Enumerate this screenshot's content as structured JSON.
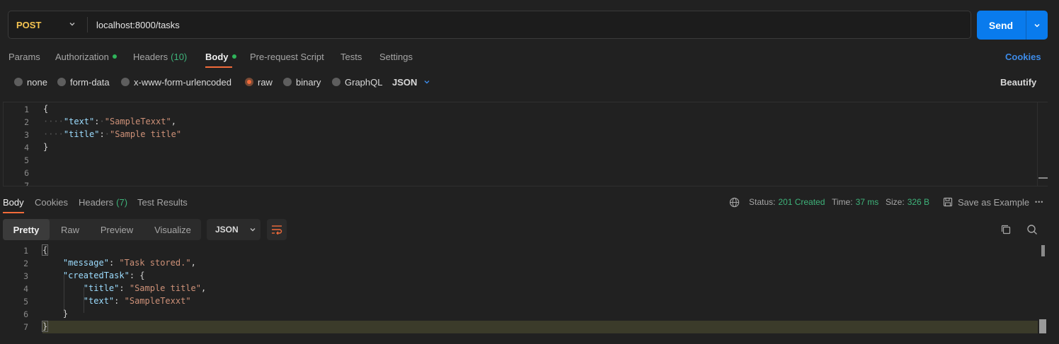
{
  "request": {
    "method": "POST",
    "url": "localhost:8000/tasks",
    "send_label": "Send"
  },
  "request_tabs": [
    {
      "label": "Params"
    },
    {
      "label": "Authorization",
      "dot": true
    },
    {
      "label": "Headers",
      "count": "(10)"
    },
    {
      "label": "Body",
      "dot": true,
      "active": true
    },
    {
      "label": "Pre-request Script"
    },
    {
      "label": "Tests"
    },
    {
      "label": "Settings"
    }
  ],
  "cookies_label": "Cookies",
  "body_types": [
    "none",
    "form-data",
    "x-www-form-urlencoded",
    "raw",
    "binary",
    "GraphQL"
  ],
  "body_type_selected": "raw",
  "body_format": "JSON",
  "beautify_label": "Beautify",
  "request_body": {
    "line_numbers": [
      "1",
      "2",
      "3",
      "4",
      "5",
      "6",
      "7"
    ],
    "text_value": "SampleTexxt",
    "title_value": "Sample title"
  },
  "response_tabs": [
    {
      "label": "Body",
      "active": true
    },
    {
      "label": "Cookies"
    },
    {
      "label": "Headers",
      "count": "(7)"
    },
    {
      "label": "Test Results"
    }
  ],
  "response_meta": {
    "status_label": "Status:",
    "status_value": "201 Created",
    "time_label": "Time:",
    "time_value": "37 ms",
    "size_label": "Size:",
    "size_value": "326 B",
    "save_example": "Save as Example",
    "more": "•••"
  },
  "view_modes": [
    "Pretty",
    "Raw",
    "Preview",
    "Visualize"
  ],
  "view_mode_selected": "Pretty",
  "response_format": "JSON",
  "response_body": {
    "line_numbers": [
      "1",
      "2",
      "3",
      "4",
      "5",
      "6",
      "7"
    ],
    "message_value": "Task stored.",
    "title_value": "Sample title",
    "text_value": "SampleTexxt"
  },
  "colors": {
    "accent_orange": "#f26b3a",
    "send_blue": "#097bed",
    "method_yellow": "#f5c451",
    "status_green": "#3eb37a",
    "link_blue": "#3d8be8"
  }
}
